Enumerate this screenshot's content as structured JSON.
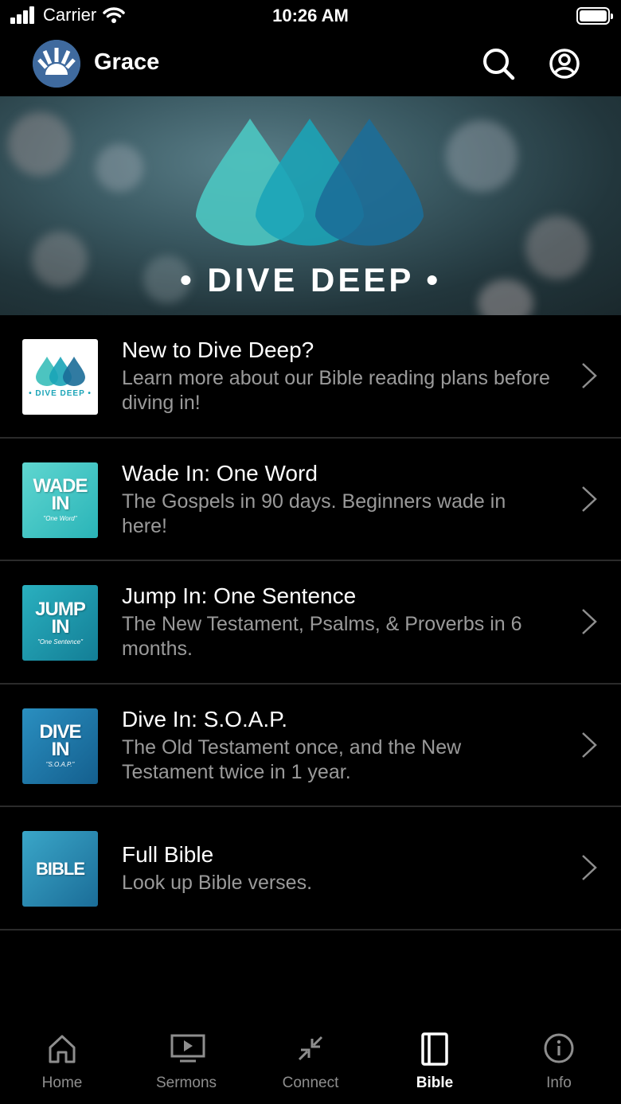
{
  "status_bar": {
    "carrier": "Carrier",
    "time": "10:26 AM"
  },
  "header": {
    "title": "Grace",
    "search_icon": "search-icon",
    "account_icon": "account-circle-icon"
  },
  "banner": {
    "title": "• DIVE DEEP •"
  },
  "plans": [
    {
      "title": "New to Dive Deep?",
      "description": "Learn more about our Bible reading plans before diving in!",
      "thumb_label": "• DIVE DEEP •"
    },
    {
      "title": "Wade In: One Word",
      "description": "The Gospels in 90 days. Beginners wade in here!",
      "thumb_line1": "WADE",
      "thumb_line2": "IN",
      "thumb_sub": "\"One Word\""
    },
    {
      "title": "Jump In: One Sentence",
      "description": "The New Testament, Psalms, & Proverbs in 6 months.",
      "thumb_line1": "JUMP",
      "thumb_line2": "IN",
      "thumb_sub": "\"One Sentence\""
    },
    {
      "title": "Dive In: S.O.A.P.",
      "description": "The Old Testament once, and the New Testament twice in 1 year.",
      "thumb_line1": "DIVE",
      "thumb_line2": "IN",
      "thumb_sub": "\"S.O.A.P.\""
    },
    {
      "title": "Full Bible",
      "description": "Look up Bible verses.",
      "thumb_line1": "BIBLE"
    }
  ],
  "tabs": [
    {
      "label": "Home",
      "icon": "home-icon"
    },
    {
      "label": "Sermons",
      "icon": "play-screen-icon"
    },
    {
      "label": "Connect",
      "icon": "connect-arrows-icon"
    },
    {
      "label": "Bible",
      "icon": "book-icon",
      "active": true
    },
    {
      "label": "Info",
      "icon": "info-icon"
    }
  ],
  "colors": {
    "background": "#000000",
    "secondary_text": "#9a9a9a",
    "tab_inactive": "#8e8e8e",
    "teal": "#3fc7c7",
    "deep_blue": "#1b6d98"
  }
}
